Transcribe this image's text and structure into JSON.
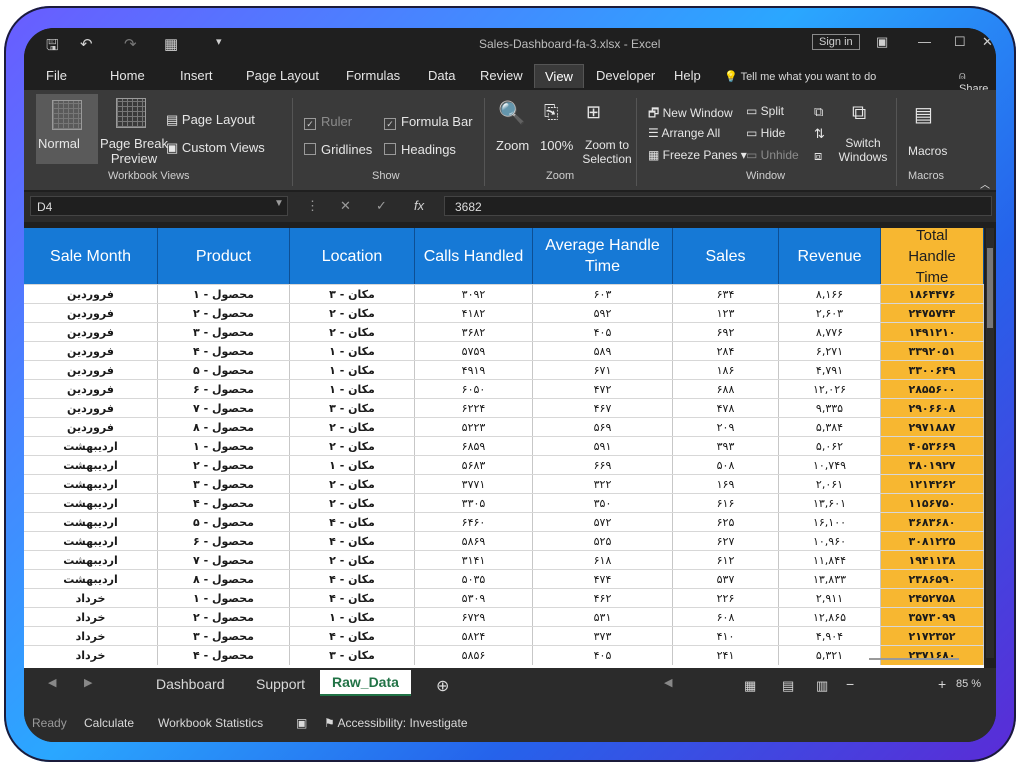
{
  "window": {
    "title": "Sales-Dashboard-fa-3.xlsx - Excel",
    "sign_in": "Sign in",
    "share": "Share",
    "tell_me": "Tell me what you want to do"
  },
  "tabs": [
    "File",
    "Home",
    "Insert",
    "Page Layout",
    "Formulas",
    "Data",
    "Review",
    "View",
    "Developer",
    "Help"
  ],
  "active_tab": "View",
  "ribbon": {
    "workbook_views": {
      "normal": "Normal",
      "page_break": "Page Break Preview",
      "page_layout": "Page Layout",
      "custom_views": "Custom Views",
      "label": "Workbook Views"
    },
    "show": {
      "ruler": "Ruler",
      "formula_bar": "Formula Bar",
      "gridlines": "Gridlines",
      "headings": "Headings",
      "label": "Show"
    },
    "zoom": {
      "zoom": "Zoom",
      "hundred": "100%",
      "zoom_selection": "Zoom to Selection",
      "label": "Zoom"
    },
    "window": {
      "new_window": "New Window",
      "arrange_all": "Arrange All",
      "freeze_panes": "Freeze Panes",
      "split": "Split",
      "hide": "Hide",
      "unhide": "Unhide",
      "switch_windows": "Switch Windows",
      "label": "Window"
    },
    "macros": {
      "macros": "Macros",
      "label": "Macros"
    }
  },
  "formula_bar": {
    "name_box": "D4",
    "value": "3682"
  },
  "columns": [
    "Sale Month",
    "Product",
    "Location",
    "Calls Handled",
    "Average Handle Time",
    "Sales",
    "Revenue",
    "Total Handle Time"
  ],
  "rows": [
    [
      "فروردین",
      "محصول - ۱",
      "مکان - ۳",
      "۳۰۹۲",
      "۶۰۳",
      "۶۳۴",
      "۸,۱۶۶",
      "۱۸۶۴۴۷۶"
    ],
    [
      "فروردین",
      "محصول - ۲",
      "مکان - ۲",
      "۴۱۸۲",
      "۵۹۲",
      "۱۲۳",
      "۲,۶۰۳",
      "۲۴۷۵۷۴۴"
    ],
    [
      "فروردین",
      "محصول - ۳",
      "مکان - ۲",
      "۳۶۸۲",
      "۴۰۵",
      "۶۹۲",
      "۸,۷۷۶",
      "۱۴۹۱۲۱۰"
    ],
    [
      "فروردین",
      "محصول - ۴",
      "مکان - ۱",
      "۵۷۵۹",
      "۵۸۹",
      "۲۸۴",
      "۶,۲۷۱",
      "۳۳۹۲۰۵۱"
    ],
    [
      "فروردین",
      "محصول - ۵",
      "مکان - ۱",
      "۴۹۱۹",
      "۶۷۱",
      "۱۸۶",
      "۴,۷۹۱",
      "۳۳۰۰۶۴۹"
    ],
    [
      "فروردین",
      "محصول - ۶",
      "مکان - ۱",
      "۶۰۵۰",
      "۴۷۲",
      "۶۸۸",
      "۱۲,۰۲۶",
      "۲۸۵۵۶۰۰"
    ],
    [
      "فروردین",
      "محصول - ۷",
      "مکان - ۳",
      "۶۲۲۴",
      "۴۶۷",
      "۴۷۸",
      "۹,۳۳۵",
      "۲۹۰۶۶۰۸"
    ],
    [
      "فروردین",
      "محصول - ۸",
      "مکان - ۲",
      "۵۲۲۳",
      "۵۶۹",
      "۲۰۹",
      "۵,۳۸۴",
      "۲۹۷۱۸۸۷"
    ],
    [
      "اردیبهشت",
      "محصول - ۱",
      "مکان - ۲",
      "۶۸۵۹",
      "۵۹۱",
      "۳۹۳",
      "۵,۰۶۲",
      "۴۰۵۳۶۶۹"
    ],
    [
      "اردیبهشت",
      "محصول - ۲",
      "مکان - ۱",
      "۵۶۸۳",
      "۶۶۹",
      "۵۰۸",
      "۱۰,۷۴۹",
      "۳۸۰۱۹۲۷"
    ],
    [
      "اردیبهشت",
      "محصول - ۳",
      "مکان - ۲",
      "۳۷۷۱",
      "۳۲۲",
      "۱۶۹",
      "۲,۰۶۱",
      "۱۲۱۴۲۶۲"
    ],
    [
      "اردیبهشت",
      "محصول - ۴",
      "مکان - ۲",
      "۳۳۰۵",
      "۳۵۰",
      "۶۱۶",
      "۱۳,۶۰۱",
      "۱۱۵۶۷۵۰"
    ],
    [
      "اردیبهشت",
      "محصول - ۵",
      "مکان - ۴",
      "۶۴۶۰",
      "۵۷۲",
      "۶۲۵",
      "۱۶,۱۰۰",
      "۳۶۸۳۶۸۰"
    ],
    [
      "اردیبهشت",
      "محصول - ۶",
      "مکان - ۴",
      "۵۸۶۹",
      "۵۲۵",
      "۶۲۷",
      "۱۰,۹۶۰",
      "۳۰۸۱۲۲۵"
    ],
    [
      "اردیبهشت",
      "محصول - ۷",
      "مکان - ۲",
      "۳۱۴۱",
      "۶۱۸",
      "۶۱۲",
      "۱۱,۸۴۴",
      "۱۹۴۱۱۳۸"
    ],
    [
      "اردیبهشت",
      "محصول - ۸",
      "مکان - ۴",
      "۵۰۳۵",
      "۴۷۴",
      "۵۳۷",
      "۱۳,۸۳۳",
      "۲۳۸۶۵۹۰"
    ],
    [
      "خرداد",
      "محصول - ۱",
      "مکان - ۴",
      "۵۳۰۹",
      "۴۶۲",
      "۲۲۶",
      "۲,۹۱۱",
      "۲۴۵۲۷۵۸"
    ],
    [
      "خرداد",
      "محصول - ۲",
      "مکان - ۱",
      "۶۷۲۹",
      "۵۳۱",
      "۶۰۸",
      "۱۲,۸۶۵",
      "۳۵۷۳۰۹۹"
    ],
    [
      "خرداد",
      "محصول - ۳",
      "مکان - ۴",
      "۵۸۲۴",
      "۳۷۳",
      "۴۱۰",
      "۴,۹۰۴",
      "۲۱۷۲۳۵۲"
    ],
    [
      "خرداد",
      "محصول - ۴",
      "مکان - ۳",
      "۵۸۵۶",
      "۴۰۵",
      "۲۴۱",
      "۵,۳۲۱",
      "۲۳۷۱۶۸۰"
    ]
  ],
  "sheets": [
    "Dashboard",
    "Support",
    "Raw_Data"
  ],
  "active_sheet": "Raw_Data",
  "status": {
    "ready": "Ready",
    "calculate": "Calculate",
    "workbook_stats": "Workbook Statistics",
    "accessibility": "Accessibility: Investigate",
    "zoom": "85 %"
  }
}
